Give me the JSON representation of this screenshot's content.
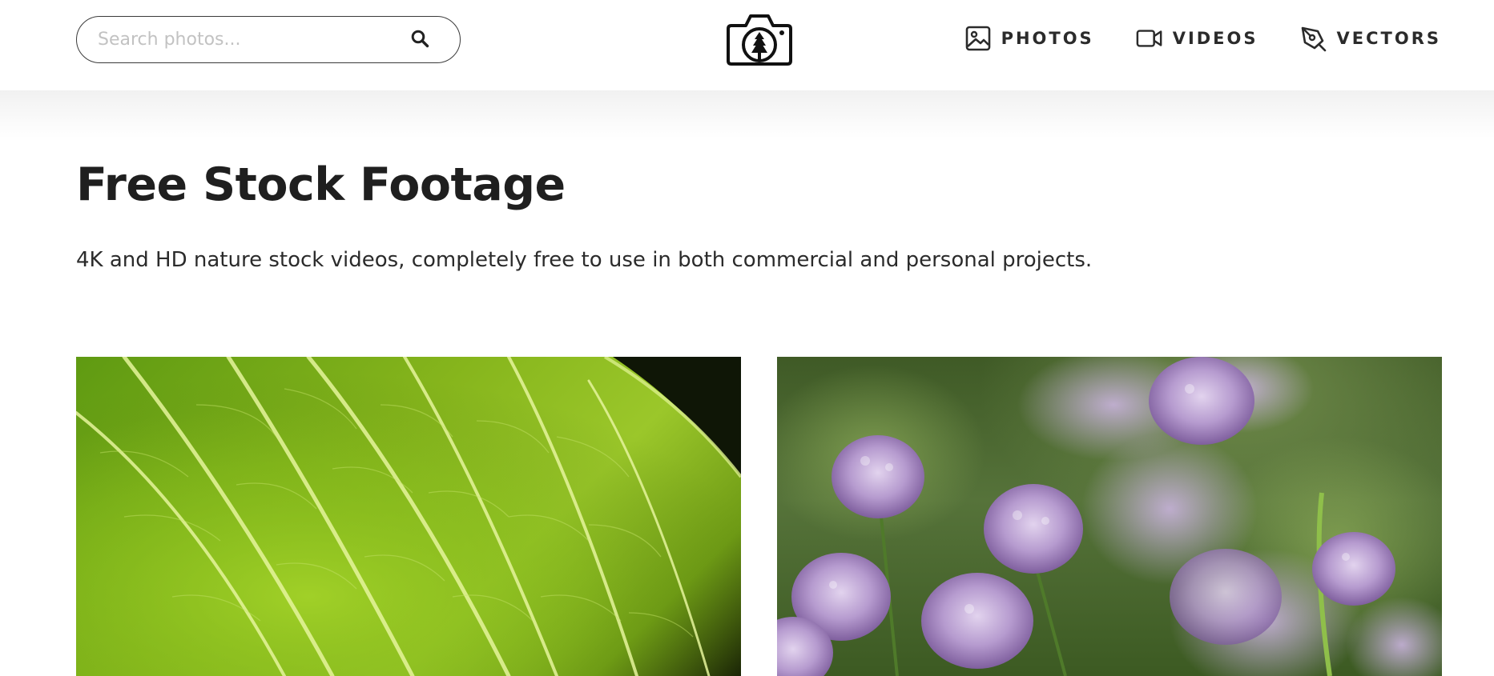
{
  "search": {
    "placeholder": "Search photos..."
  },
  "logo": {
    "icon": "camera-tree-logo"
  },
  "nav": {
    "items": [
      {
        "label": "PHOTOS",
        "icon": "image-icon"
      },
      {
        "label": "VIDEOS",
        "icon": "video-camera-icon"
      },
      {
        "label": "VECTORS",
        "icon": "pen-nib-icon"
      }
    ]
  },
  "main": {
    "title": "Free Stock Footage",
    "subtitle": "4K and HD nature stock videos, completely free to use in both commercial and personal projects."
  },
  "videos": [
    {
      "subject": "green-leaf-closeup",
      "accent": "#8cc21e"
    },
    {
      "subject": "purple-chive-flowers",
      "accent": "#b59bd0"
    }
  ]
}
